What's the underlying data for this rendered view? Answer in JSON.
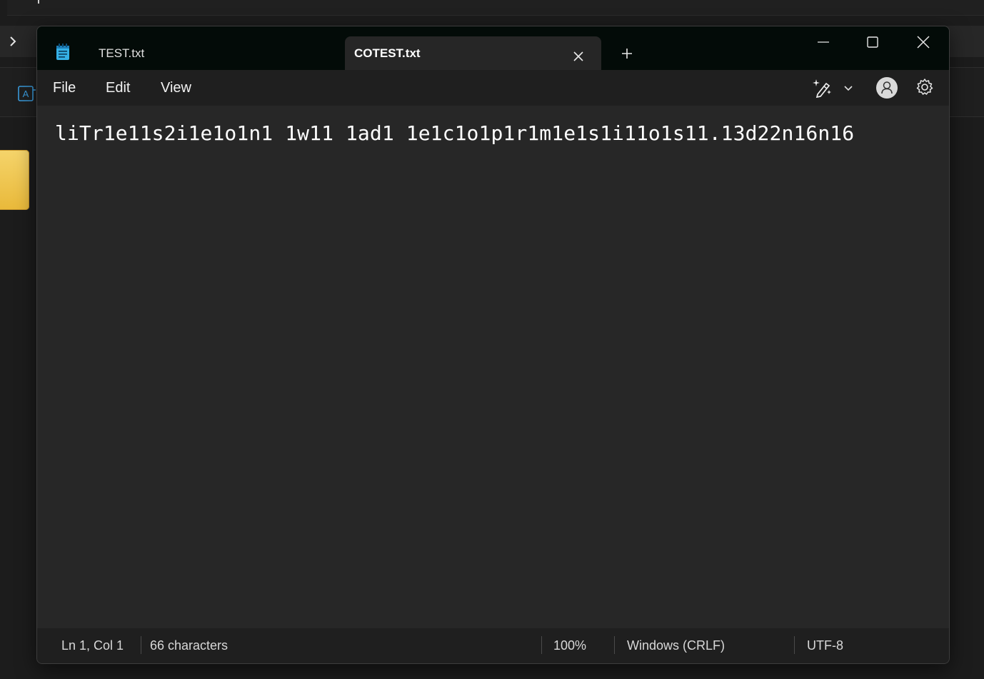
{
  "window": {
    "tabs": [
      {
        "label": "TEST.txt",
        "active": false
      },
      {
        "label": "COTEST.txt",
        "active": true
      }
    ]
  },
  "menu": {
    "file": "File",
    "edit": "Edit",
    "view": "View"
  },
  "editor": {
    "content": "liTr1e11s2i1e1o1n1 1w11 1ad1 1e1c1o1p1r1m1e1s1i11o1s11.13d22n16n16"
  },
  "status": {
    "position": "Ln 1, Col 1",
    "characters": "66 characters",
    "zoom": "100%",
    "line_ending": "Windows (CRLF)",
    "encoding": "UTF-8"
  },
  "icons": {
    "app": "notepad-icon",
    "tab_close": "close-icon",
    "new_tab": "plus-icon",
    "minimize": "minimize-icon",
    "maximize": "maximize-icon",
    "close": "close-icon",
    "copilot": "copilot-pen-icon",
    "account": "account-icon",
    "settings": "gear-icon"
  },
  "colors": {
    "titlebar": "#030b08",
    "editor_bg": "#272727",
    "statusbar_bg": "#1f1f1f",
    "text": "#ffffff"
  }
}
